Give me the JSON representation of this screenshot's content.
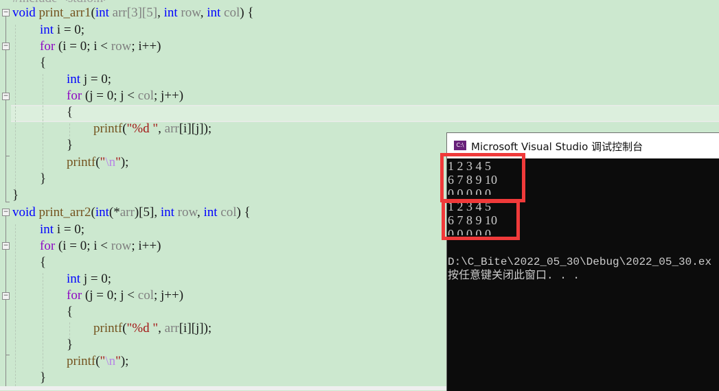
{
  "editor": {
    "partial_top_line": "#include <stdio.h>",
    "func1": {
      "signature": {
        "kw_void": "void",
        "name": "print_arr1",
        "open": "(",
        "kw_int1": "int",
        "p1": "arr[3][5]",
        "sep1": ", ",
        "kw_int2": "int",
        "p2": "row",
        "sep2": ", ",
        "kw_int3": "int",
        "p3": "col",
        "close": ") {"
      },
      "decl_i": {
        "kw": "int",
        "rest": " i = 0;"
      },
      "for_i": {
        "kw": "for",
        "a": " (i = 0; i < ",
        "b": "row",
        "c": "; i++)"
      },
      "open_brace": "{",
      "decl_j": {
        "kw": "int",
        "rest": " j = 0;"
      },
      "for_j": {
        "kw": "for",
        "a": " (j = 0; j < ",
        "b": "col",
        "c": "; j++)"
      },
      "inner_open": "{",
      "printf1": {
        "fn": "printf",
        "a": "(",
        "str": "\"%d \"",
        "b": ", ",
        "arr": "arr",
        "c": "[i][j]);"
      },
      "inner_close": "}",
      "printf2": {
        "fn": "printf",
        "a": "(",
        "q1": "\"",
        "esc": "\\n",
        "q2": "\"",
        "b": ");"
      },
      "close_brace": "}",
      "func_close": "}"
    },
    "func2": {
      "signature": {
        "kw_void": "void",
        "name": "print_arr2",
        "open": "(",
        "kw_int1": "int",
        "p1a": "(*",
        "p1b": "arr",
        "p1c": ")[5]",
        "sep1": ", ",
        "kw_int2": "int",
        "p2": "row",
        "sep2": ", ",
        "kw_int3": "int",
        "p3": "col",
        "close": ") {"
      },
      "decl_i": {
        "kw": "int",
        "rest": " i = 0;"
      },
      "for_i": {
        "kw": "for",
        "a": " (i = 0; i < ",
        "b": "row",
        "c": "; i++)"
      },
      "open_brace": "{",
      "decl_j": {
        "kw": "int",
        "rest": " j = 0;"
      },
      "for_j": {
        "kw": "for",
        "a": " (j = 0; j < ",
        "b": "col",
        "c": "; j++)"
      },
      "inner_open": "{",
      "printf1": {
        "fn": "printf",
        "a": "(",
        "str": "\"%d \"",
        "b": ", ",
        "arr": "arr",
        "c": "[i][j]);"
      },
      "inner_close": "}",
      "printf2": {
        "fn": "printf",
        "a": "(",
        "q1": "\"",
        "esc": "\\n",
        "q2": "\"",
        "b": ");"
      },
      "close_brace": "}"
    },
    "fold_glyph": "−"
  },
  "console": {
    "title": "Microsoft Visual Studio 调试控制台",
    "icon_label": "C:\\",
    "output_lines": [
      "1 2 3 4 5",
      "6 7 8 9 10",
      "0 0 0 0 0",
      "1 2 3 4 5",
      "6 7 8 9 10",
      "0 0 0 0 0"
    ],
    "exit_path": "D:\\C_Bite\\2022_05_30\\Debug\\2022_05_30.ex",
    "press_key": "按任意键关闭此窗口. . ."
  },
  "colors": {
    "editor_bg": "#cce8cf",
    "console_bg": "#0c0c0c",
    "highlight_box": "#f03a3a",
    "keyword": "#0000ff",
    "flow": "#8f08c4",
    "function": "#74531f",
    "string": "#a31515"
  }
}
